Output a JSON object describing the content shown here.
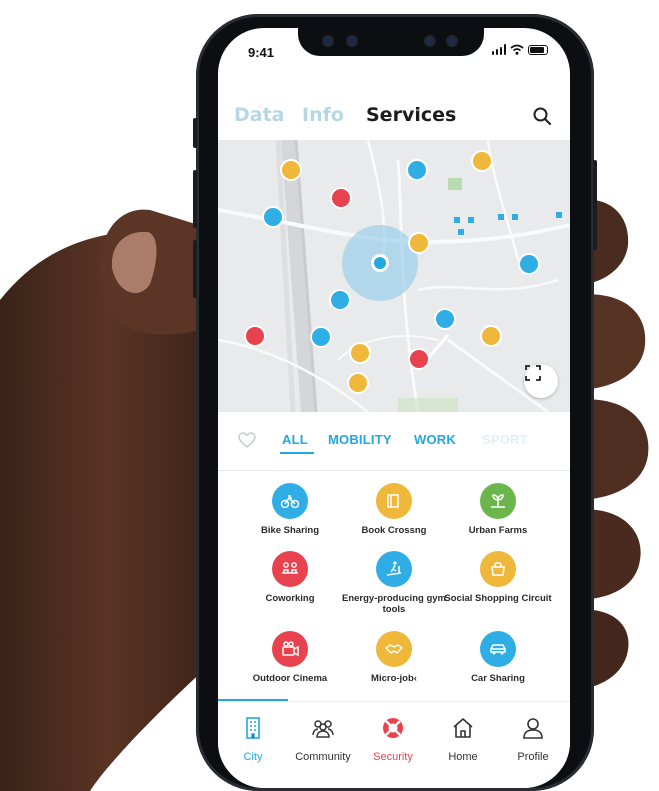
{
  "status_bar": {
    "time": "9:41"
  },
  "header": {
    "tabs": [
      {
        "label": "Data",
        "active": false
      },
      {
        "label": "Info",
        "active": false
      },
      {
        "label": "Services",
        "active": true
      }
    ]
  },
  "categories": {
    "items": [
      {
        "label": "ALL",
        "selected": true
      },
      {
        "label": "MOBILITY",
        "selected": false
      },
      {
        "label": "WORK",
        "selected": false
      },
      {
        "label": "SPORT",
        "selected": false
      }
    ]
  },
  "services": [
    {
      "label": "Bike Sharing",
      "icon": "bike-icon",
      "color": "#2eaee5"
    },
    {
      "label": "Book Crossng",
      "icon": "book-icon",
      "color": "#efb83a"
    },
    {
      "label": "Urban Farms",
      "icon": "farm-icon",
      "color": "#6bb64a"
    },
    {
      "label": "Coworking",
      "icon": "coworking-icon",
      "color": "#e8424e"
    },
    {
      "label": "Energy-producing gym tools",
      "icon": "treadmill-icon",
      "color": "#2eaee5"
    },
    {
      "label": "Social Shopping Circuit",
      "icon": "shopping-icon",
      "color": "#efb83a"
    },
    {
      "label": "Outdoor Cinema",
      "icon": "cinema-icon",
      "color": "#e8424e"
    },
    {
      "label": "Micro-job‹",
      "icon": "handshake-icon",
      "color": "#efb83a"
    },
    {
      "label": "Car Sharing",
      "icon": "car-icon",
      "color": "#2eaee5"
    }
  ],
  "nav": [
    {
      "label": "City",
      "icon": "building-icon",
      "active": true,
      "color": "#23a7e0"
    },
    {
      "label": "Community",
      "icon": "community-icon",
      "active": false,
      "color": "#333333"
    },
    {
      "label": "Security",
      "icon": "lifebuoy-icon",
      "active": false,
      "color": "#e8424e"
    },
    {
      "label": "Home",
      "icon": "home-icon",
      "active": false,
      "color": "#333333"
    },
    {
      "label": "Profile",
      "icon": "profile-icon",
      "active": false,
      "color": "#333333"
    }
  ],
  "colors": {
    "accent": "#23a7e0",
    "red": "#e8424e",
    "yellow": "#efb83a",
    "green": "#6bb64a"
  }
}
